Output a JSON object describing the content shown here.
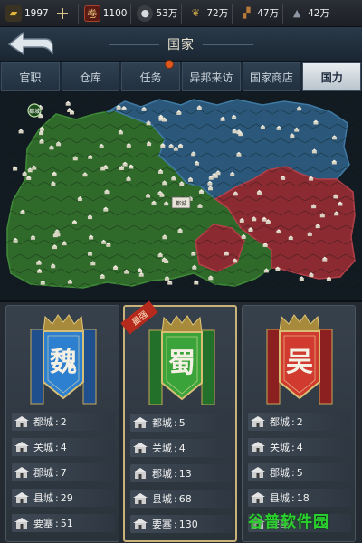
{
  "resources": [
    {
      "icon": "gold-ingot-icon",
      "value": "1997",
      "color": "#e3b53c"
    },
    {
      "icon": "scroll-token-icon",
      "value": "1100",
      "color": "#c33a2a"
    },
    {
      "icon": "silver-coin-icon",
      "value": "53万",
      "color": "#c9ccd1"
    },
    {
      "icon": "grain-icon",
      "value": "72万",
      "color": "#c9a24a"
    },
    {
      "icon": "wood-icon",
      "value": "47万",
      "color": "#b87a3a"
    },
    {
      "icon": "iron-icon",
      "value": "42万",
      "color": "#8e97a3"
    }
  ],
  "header": {
    "title": "国家"
  },
  "tabs": [
    {
      "label": "官职"
    },
    {
      "label": "仓库"
    },
    {
      "label": "任务"
    },
    {
      "label": "异邦来访"
    },
    {
      "label": "国家商店"
    },
    {
      "label": "国力"
    }
  ],
  "active_tab": "国力",
  "map": {
    "colors": {
      "wei": "#2c5f7e",
      "shu": "#2f6a2a",
      "wu": "#8c2a32"
    },
    "capital_label": "都城"
  },
  "kingdoms": [
    {
      "name": "魏",
      "color": "#2d7fd0",
      "banner": "#1f4f8c",
      "stats": [
        {
          "label": "都城",
          "value": "2"
        },
        {
          "label": "关城",
          "value": "4"
        },
        {
          "label": "郡城",
          "value": "7"
        },
        {
          "label": "县城",
          "value": "29"
        },
        {
          "label": "要塞",
          "value": "51"
        }
      ]
    },
    {
      "name": "蜀",
      "color": "#3aa43a",
      "banner": "#22702a",
      "ribbon": "最强",
      "stats": [
        {
          "label": "都城",
          "value": "5"
        },
        {
          "label": "关城",
          "value": "4"
        },
        {
          "label": "郡城",
          "value": "13"
        },
        {
          "label": "县城",
          "value": "68"
        },
        {
          "label": "要塞",
          "value": "130"
        }
      ]
    },
    {
      "name": "吴",
      "color": "#d13a2e",
      "banner": "#8c1f1f",
      "stats": [
        {
          "label": "都城",
          "value": "2"
        },
        {
          "label": "关城",
          "value": "4"
        },
        {
          "label": "郡城",
          "value": "5"
        },
        {
          "label": "县城",
          "value": "18"
        },
        {
          "label": "要塞",
          "value": ""
        }
      ]
    }
  ],
  "watermark": "谷普软件园"
}
